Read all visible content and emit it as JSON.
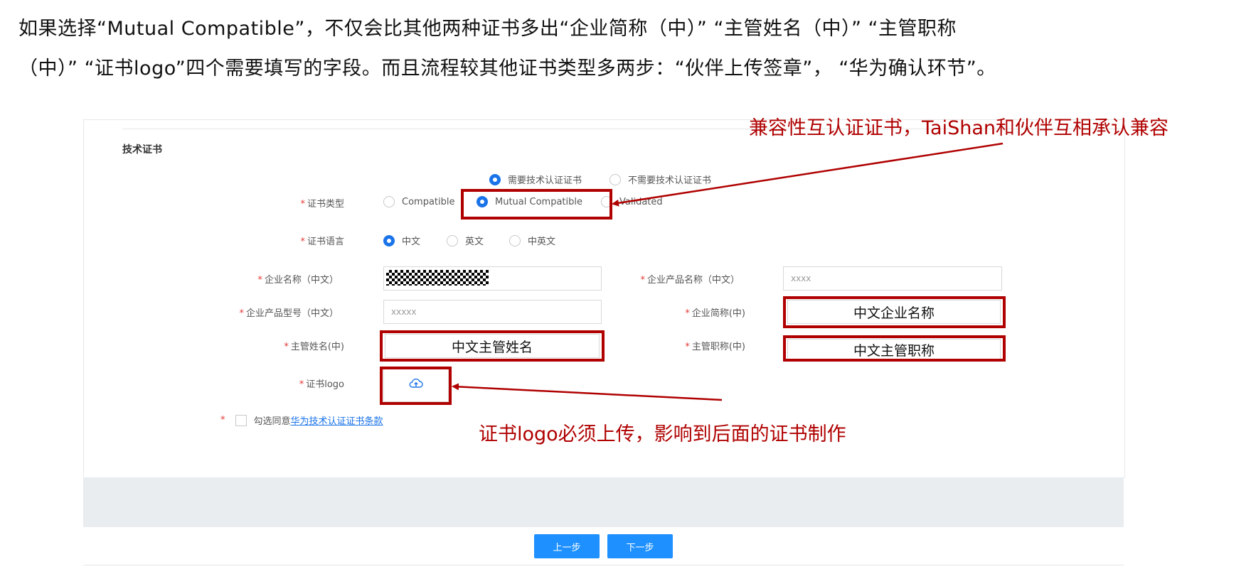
{
  "intro": {
    "line1": "如果选择“Mutual Compatible”，不仅会比其他两种证书多出“企业简称（中）” “主管姓名（中）” “主管职称",
    "line2": "（中）” “证书logo”四个需要填写的字段。而且流程较其他证书类型多两步：“伙伴上传签章”， “华为确认环节”。"
  },
  "form": {
    "section_title": "技术证书",
    "cert_need": {
      "options": [
        "需要技术认证证书",
        "不需要技术认证证书"
      ],
      "selected": "需要技术认证证书"
    },
    "cert_type": {
      "label": "证书类型",
      "options": [
        "Compatible",
        "Mutual Compatible",
        "Validated"
      ],
      "selected": "Mutual Compatible"
    },
    "cert_lang": {
      "label": "证书语言",
      "options": [
        "中文",
        "英文",
        "中英文"
      ],
      "selected": "中文"
    },
    "fields": {
      "company_name_label": "企业名称（中文）",
      "product_name_label": "企业产品名称（中文）",
      "product_name_value": "xxxx",
      "product_model_label": "企业产品型号（中文）",
      "product_model_value": "xxxxx",
      "company_short_label": "企业简称(中)",
      "company_short_value": "中文企业名称",
      "manager_name_label": "主管姓名(中)",
      "manager_name_value": "中文主管姓名",
      "manager_title_label": "主管职称(中)",
      "manager_title_value": "中文主管职称",
      "logo_label": "证书logo"
    },
    "required_mark": "*",
    "agree": {
      "prefix": "勾选同意",
      "link": "华为技术认证证书条款"
    },
    "buttons": {
      "prev": "上一步",
      "next": "下一步"
    }
  },
  "annotations": {
    "top": "兼容性互认证证书，TaiShan和伙伴互相承认兼容",
    "logo": "证书logo必须上传，影响到后面的证书制作"
  },
  "colors": {
    "accent": "#1a73e8",
    "highlight": "#b00000",
    "required": "#e53935"
  },
  "icons": {
    "upload": "cloud-upload-icon"
  }
}
